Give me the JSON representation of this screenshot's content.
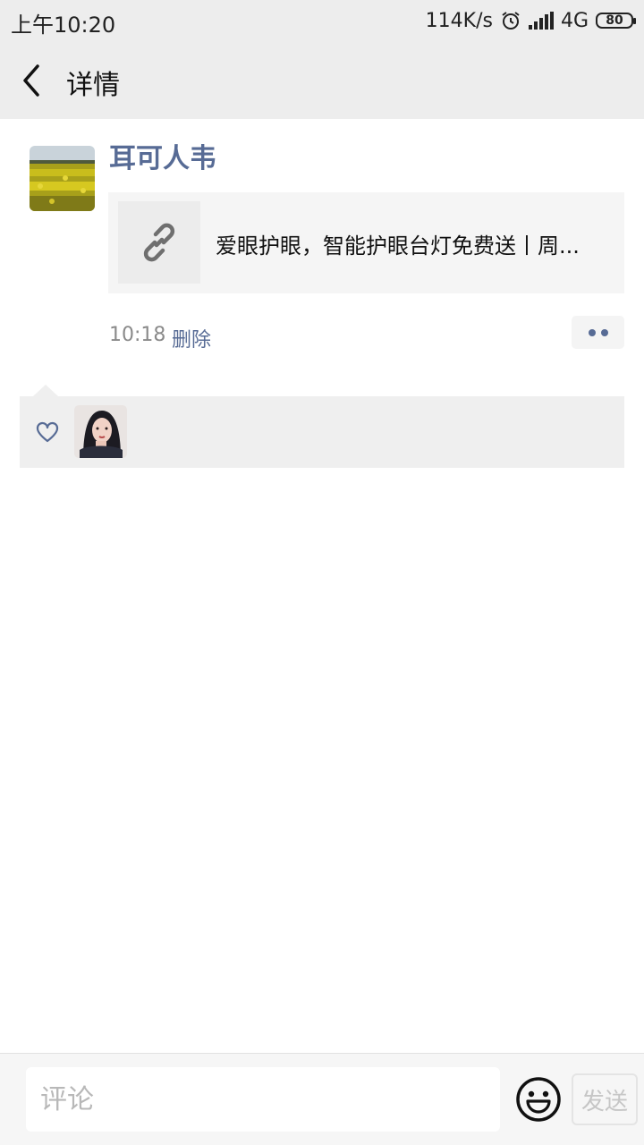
{
  "status_bar": {
    "time": "上午10:20",
    "net_speed": "114K/s",
    "network": "4G",
    "battery": "80"
  },
  "nav": {
    "title": "详情",
    "back_icon": "chevron-left-icon"
  },
  "post": {
    "author": "耳可人韦",
    "link_title": "爱眼护眼，智能护眼台灯免费送丨周...",
    "link_icon": "link-icon",
    "time": "10:18",
    "delete_label": "删除"
  },
  "likes": {
    "icon": "heart-icon"
  },
  "comment_bar": {
    "placeholder": "评论",
    "emoji_icon": "smiley-icon",
    "send_label": "发送"
  },
  "colors": {
    "accent": "#576b95",
    "header_bg": "#ededed",
    "card_bg": "#f5f5f5"
  }
}
